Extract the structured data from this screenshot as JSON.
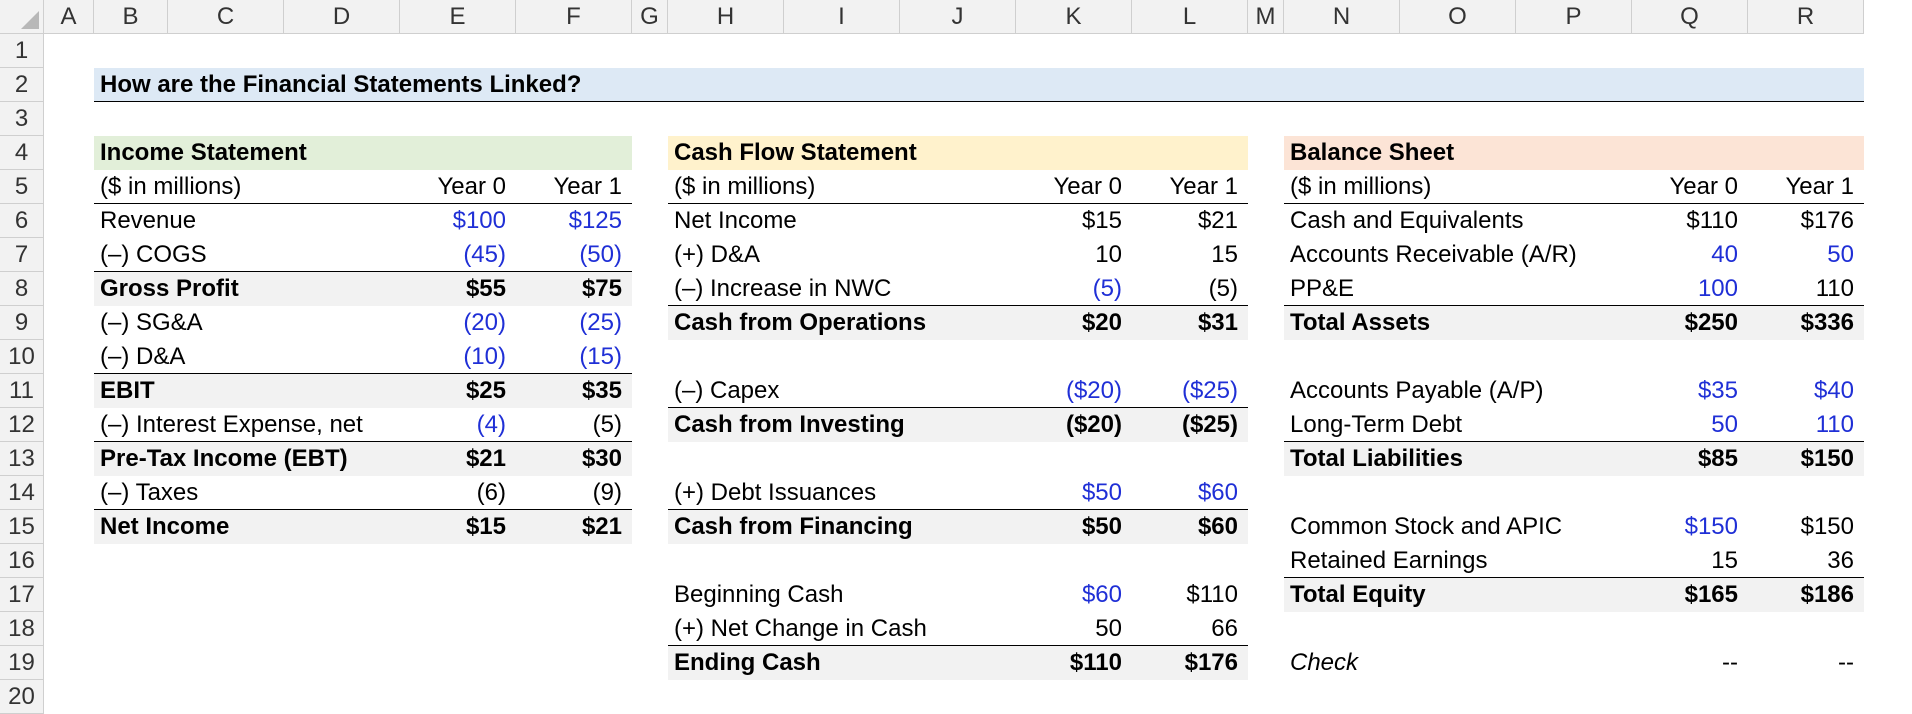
{
  "columns": [
    "A",
    "B",
    "C",
    "D",
    "E",
    "F",
    "G",
    "H",
    "I",
    "J",
    "K",
    "L",
    "M",
    "N",
    "O",
    "P",
    "Q",
    "R"
  ],
  "rows": [
    "1",
    "2",
    "3",
    "4",
    "5",
    "6",
    "7",
    "8",
    "9",
    "10",
    "11",
    "12",
    "13",
    "14",
    "15",
    "16",
    "17",
    "18",
    "19",
    "20"
  ],
  "title": "How are the Financial Statements Linked?",
  "colors": {
    "title_fill": "#dde9f5",
    "is_header": "#e2efd9",
    "cf_header": "#fff2cc",
    "bs_header": "#fce4d6",
    "total_fill": "#f2f2f2",
    "input_blue": "#1f2fd6"
  },
  "income": {
    "header": "Income Statement",
    "units": "($ in millions)",
    "y0": "Year 0",
    "y1": "Year 1",
    "rows": [
      {
        "label": "Revenue",
        "v0": "$100",
        "v1": "$125"
      },
      {
        "label": "(–) COGS",
        "v0": "(45)",
        "v1": "(50)"
      },
      {
        "label": "Gross Profit",
        "v0": "$55",
        "v1": "$75"
      },
      {
        "label": "(–) SG&A",
        "v0": "(20)",
        "v1": "(25)"
      },
      {
        "label": "(–) D&A",
        "v0": "(10)",
        "v1": "(15)"
      },
      {
        "label": "EBIT",
        "v0": "$25",
        "v1": "$35"
      },
      {
        "label": "(–) Interest Expense, net",
        "v0": "(4)",
        "v1": "(5)"
      },
      {
        "label": "Pre-Tax Income (EBT)",
        "v0": "$21",
        "v1": "$30"
      },
      {
        "label": "(–) Taxes",
        "v0": "(6)",
        "v1": "(9)"
      },
      {
        "label": "Net Income",
        "v0": "$15",
        "v1": "$21"
      }
    ]
  },
  "cashflow": {
    "header": "Cash Flow Statement",
    "units": "($ in millions)",
    "y0": "Year 0",
    "y1": "Year 1",
    "rows": [
      {
        "label": "Net Income",
        "v0": "$15",
        "v1": "$21"
      },
      {
        "label": "(+) D&A",
        "v0": "10",
        "v1": "15"
      },
      {
        "label": "(–) Increase in NWC",
        "v0": "(5)",
        "v1": "(5)"
      },
      {
        "label": "Cash from Operations",
        "v0": "$20",
        "v1": "$31"
      },
      {
        "label": "(–) Capex",
        "v0": "($20)",
        "v1": "($25)"
      },
      {
        "label": "Cash from Investing",
        "v0": "($20)",
        "v1": "($25)"
      },
      {
        "label": "(+) Debt Issuances",
        "v0": "$50",
        "v1": "$60"
      },
      {
        "label": "Cash from Financing",
        "v0": "$50",
        "v1": "$60"
      },
      {
        "label": "Beginning Cash",
        "v0": "$60",
        "v1": "$110"
      },
      {
        "label": "(+) Net Change in Cash",
        "v0": "50",
        "v1": "66"
      },
      {
        "label": "Ending Cash",
        "v0": "$110",
        "v1": "$176"
      }
    ]
  },
  "balance": {
    "header": "Balance Sheet",
    "units": "($ in millions)",
    "y0": "Year 0",
    "y1": "Year 1",
    "rows": [
      {
        "label": "Cash and Equivalents",
        "v0": "$110",
        "v1": "$176"
      },
      {
        "label": "Accounts Receivable (A/R)",
        "v0": "40",
        "v1": "50"
      },
      {
        "label": "PP&E",
        "v0": "100",
        "v1": "110"
      },
      {
        "label": "Total Assets",
        "v0": "$250",
        "v1": "$336"
      },
      {
        "label": "Accounts Payable (A/P)",
        "v0": "$35",
        "v1": "$40"
      },
      {
        "label": "Long-Term Debt",
        "v0": "50",
        "v1": "110"
      },
      {
        "label": "Total Liabilities",
        "v0": "$85",
        "v1": "$150"
      },
      {
        "label": "Common Stock and APIC",
        "v0": "$150",
        "v1": "$150"
      },
      {
        "label": "Retained Earnings",
        "v0": "15",
        "v1": "36"
      },
      {
        "label": "Total Equity",
        "v0": "$165",
        "v1": "$186"
      },
      {
        "label": "Check",
        "v0": "--",
        "v1": "--"
      }
    ]
  }
}
